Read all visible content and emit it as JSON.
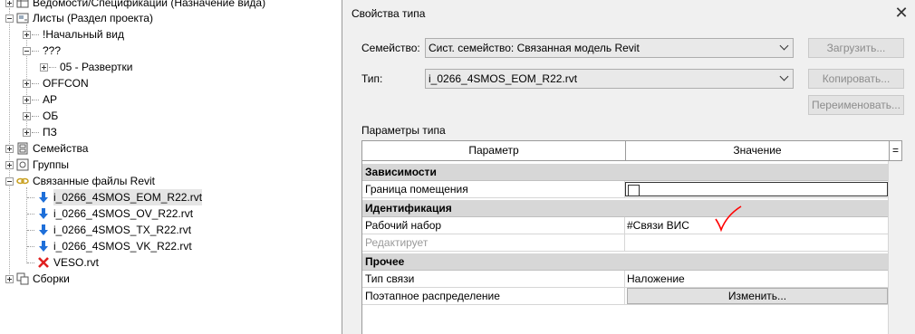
{
  "tree": {
    "items": [
      {
        "label": "Ведомости/Спецификации (Назначение вида)",
        "icon": "schedule-icon"
      },
      {
        "label": "Листы (Раздел проекта)",
        "icon": "sheets-icon"
      },
      {
        "label": "!Начальный вид"
      },
      {
        "label": "???"
      },
      {
        "label": "05 - Развертки"
      },
      {
        "label": "OFFCON"
      },
      {
        "label": "АР"
      },
      {
        "label": "ОБ"
      },
      {
        "label": "ПЗ"
      },
      {
        "label": "Семейства",
        "icon": "families-icon"
      },
      {
        "label": "Группы",
        "icon": "groups-icon"
      },
      {
        "label": "Связанные файлы Revit",
        "icon": "link-icon"
      },
      {
        "label": "i_0266_4SMOS_EOM_R22.rvt",
        "icon": "link-arrow-icon"
      },
      {
        "label": "i_0266_4SMOS_OV_R22.rvt",
        "icon": "link-arrow-icon"
      },
      {
        "label": "i_0266_4SMOS_TX_R22.rvt",
        "icon": "link-arrow-icon"
      },
      {
        "label": "i_0266_4SMOS_VK_R22.rvt",
        "icon": "link-arrow-icon"
      },
      {
        "label": "VESO.rvt",
        "icon": "unloaded-x-icon"
      },
      {
        "label": "Сборки",
        "icon": "assemblies-icon"
      }
    ]
  },
  "dialog": {
    "title": "Свойства типа",
    "family_label": "Семейство:",
    "family_value": "Сист. семейство: Связанная модель Revit",
    "type_label": "Тип:",
    "type_value": "i_0266_4SMOS_EOM_R22.rvt",
    "load_button": "Загрузить...",
    "copy_button": "Копировать...",
    "rename_button": "Переименовать...",
    "params_label": "Параметры типа",
    "col_param": "Параметр",
    "col_value": "Значение",
    "col_extra": "=",
    "groups": [
      {
        "name": "Зависимости",
        "rows": [
          {
            "param": "Граница помещения",
            "value": "",
            "checkbox": true
          }
        ]
      },
      {
        "name": "Идентификация",
        "rows": [
          {
            "param": "Рабочий набор",
            "value": "#Связи ВИС"
          },
          {
            "param": "Редактирует",
            "value": "",
            "disabled": true
          }
        ]
      },
      {
        "name": "Прочее",
        "rows": [
          {
            "param": "Тип связи",
            "value": "Наложение"
          },
          {
            "param": "Поэтапное распределение",
            "value": "Изменить...",
            "button": true
          }
        ]
      }
    ],
    "collapse_glyph": "«"
  },
  "colors": {
    "annotation_mark": "#ff0000",
    "link_arrow": "#1e6fd9",
    "unloaded": "#e02020",
    "link_chain": "#c9a020"
  }
}
